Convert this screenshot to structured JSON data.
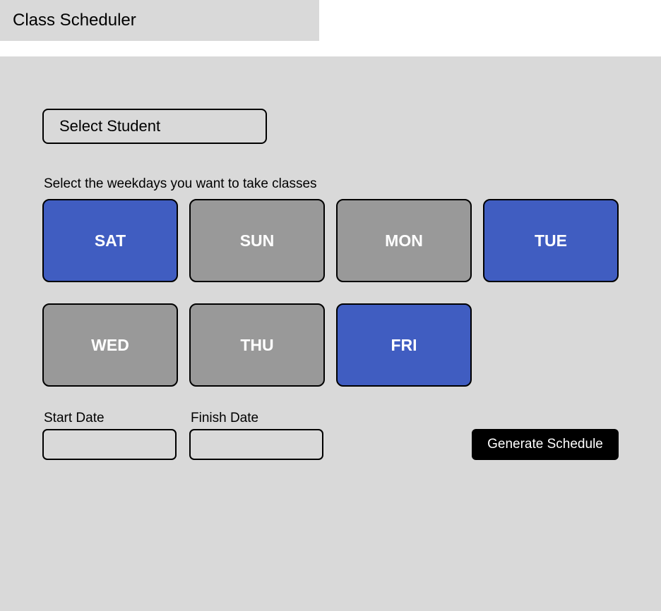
{
  "app": {
    "title": "Class Scheduler"
  },
  "student_select": {
    "label": "Select Student"
  },
  "weekdays": {
    "prompt": "Select the weekdays you want to take classes",
    "days": [
      {
        "label": "SAT",
        "selected": true
      },
      {
        "label": "SUN",
        "selected": false
      },
      {
        "label": "MON",
        "selected": false
      },
      {
        "label": "TUE",
        "selected": true
      },
      {
        "label": "WED",
        "selected": false
      },
      {
        "label": "THU",
        "selected": false
      },
      {
        "label": "FRI",
        "selected": true
      }
    ]
  },
  "dates": {
    "start_label": "Start Date",
    "start_value": "",
    "finish_label": "Finish Date",
    "finish_value": ""
  },
  "actions": {
    "generate_label": "Generate Schedule"
  },
  "colors": {
    "selected_day": "#405dc1",
    "unselected_day": "#999999",
    "panel_background": "#d9d9d9",
    "primary_button": "#000000"
  }
}
